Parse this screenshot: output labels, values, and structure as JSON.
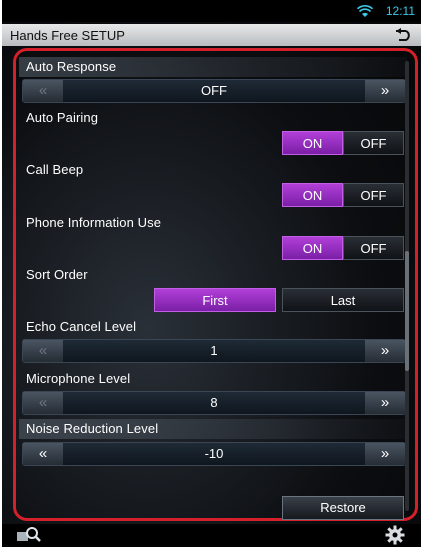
{
  "status": {
    "clock": "12:11"
  },
  "header": {
    "title": "Hands Free SETUP"
  },
  "settings": {
    "auto_response": {
      "label": "Auto Response",
      "value": "OFF",
      "prev": "«",
      "next": "»"
    },
    "auto_pairing": {
      "label": "Auto Pairing",
      "on": "ON",
      "off": "OFF",
      "selected": "ON"
    },
    "call_beep": {
      "label": "Call Beep",
      "on": "ON",
      "off": "OFF",
      "selected": "ON"
    },
    "phone_info": {
      "label": "Phone Information Use",
      "on": "ON",
      "off": "OFF",
      "selected": "ON"
    },
    "sort_order": {
      "label": "Sort Order",
      "first": "First",
      "last": "Last",
      "selected": "First"
    },
    "echo_cancel": {
      "label": "Echo Cancel Level",
      "value": "1",
      "prev": "«",
      "next": "»"
    },
    "mic_level": {
      "label": "Microphone Level",
      "value": "8",
      "prev": "«",
      "next": "»"
    },
    "noise_reduction": {
      "label": "Noise Reduction Level",
      "value": "-10",
      "prev": "«",
      "next": "»"
    }
  },
  "footer": {
    "restore_label": "Restore"
  },
  "colors": {
    "accent": "#a030cc",
    "frame": "#d4202a",
    "clock": "#3cc8e8"
  },
  "icons": {
    "wifi": "wifi-icon",
    "back": "back-icon",
    "search": "search-icon",
    "settings": "gear-icon"
  }
}
